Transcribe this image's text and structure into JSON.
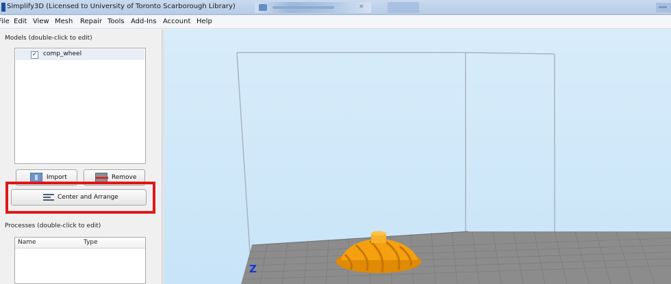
{
  "window": {
    "title": "Simplify3D (Licensed to University of Toronto Scarborough Library)"
  },
  "menu": {
    "items": [
      "File",
      "Edit",
      "View",
      "Mesh",
      "Repair",
      "Tools",
      "Add-Ins",
      "Account",
      "Help"
    ]
  },
  "models": {
    "section_label": "Models (double-click to edit)",
    "items": [
      {
        "name": "comp_wheel",
        "checked": true,
        "check_mark": "✓"
      }
    ]
  },
  "buttons": {
    "import": "Import",
    "remove": "Remove",
    "center_arrange": "Center and Arrange"
  },
  "processes": {
    "section_label": "Processes (double-click to edit)",
    "columns": [
      "Name",
      "Type"
    ]
  },
  "viewport": {
    "axis_label": "Z",
    "model_color": "#f5a10f",
    "bed_color": "#8c8c8c",
    "background_color": "#cfe8fa"
  },
  "colors": {
    "highlight": "#e01818"
  }
}
